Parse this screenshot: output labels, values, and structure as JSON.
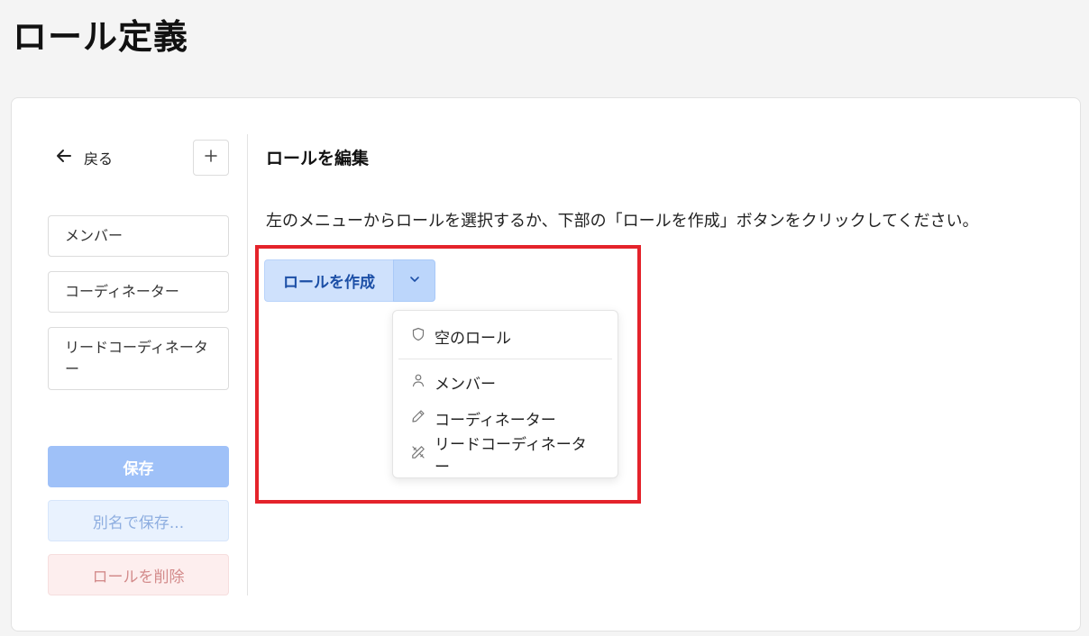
{
  "page": {
    "title": "ロール定義"
  },
  "sidebar": {
    "back_label": "戻る",
    "roles": [
      {
        "label": "メンバー"
      },
      {
        "label": "コーディネーター"
      },
      {
        "label": "リードコーディネーター"
      }
    ],
    "save_label": "保存",
    "save_as_label": "別名で保存...",
    "delete_label": "ロールを削除"
  },
  "main": {
    "title": "ロールを編集",
    "description": "左のメニューからロールを選択するか、下部の「ロールを作成」ボタンをクリックしてください。",
    "create_label": "ロールを作成",
    "menu": {
      "empty_role": {
        "label": "空のロール",
        "icon": "shield-icon"
      },
      "templates": [
        {
          "label": "メンバー",
          "icon": "user-icon"
        },
        {
          "label": "コーディネーター",
          "icon": "pencil-icon"
        },
        {
          "label": "リードコーディネーター",
          "icon": "tools-icon"
        }
      ]
    }
  },
  "colors": {
    "primary_light": "#cfe1fc",
    "primary_text": "#1c4fa6",
    "highlight": "#e4232b"
  }
}
